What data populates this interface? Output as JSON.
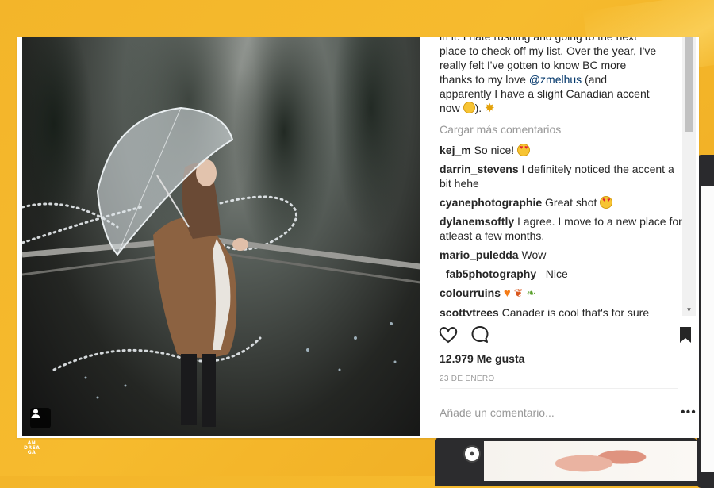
{
  "post": {
    "caption": {
      "line1": "in it. I hate rushing and going to the next",
      "line2": "place to check off my list. Over the year, I've",
      "line3": "really felt I've gotten to know BC more",
      "line4_prefix": "thanks to my love ",
      "mention": "@zmelhus",
      "line4_suffix": " (and",
      "line5": "apparently I have a slight Canadian accent",
      "line6_prefix": "now ",
      "line6_suffix": "). "
    },
    "load_more": "Cargar más comentarios",
    "comments": [
      {
        "user": "kej_m",
        "text": "So nice!"
      },
      {
        "user": "darrin_stevens",
        "text": "I definitely noticed the accent a bit hehe"
      },
      {
        "user": "cyanephotographie",
        "text": "Great shot"
      },
      {
        "user": "dylanemsoftly",
        "text": "I agree. I move to a new place for atleast a few months."
      },
      {
        "user": "mario_puledda",
        "text": "Wow"
      },
      {
        "user": "_fab5photography_",
        "text": "Nice"
      },
      {
        "user": "colourruins",
        "text": ""
      },
      {
        "user": "scottytrees",
        "text": "Canader is cool that's for sure"
      }
    ],
    "likes_count": "12.979",
    "likes_label": "Me gusta",
    "date": "23 DE ENERO",
    "comment_placeholder": "Añade un comentario...",
    "more_options": "•••"
  },
  "icons": {
    "like": "heart-icon",
    "comment": "comment-bubble-icon",
    "save": "bookmark-icon",
    "tagged_user": "user-tag-icon"
  },
  "watermark": "AN DREA GA",
  "colors": {
    "background": "#f3b52a",
    "mention": "#003569",
    "muted_text": "#999999"
  }
}
